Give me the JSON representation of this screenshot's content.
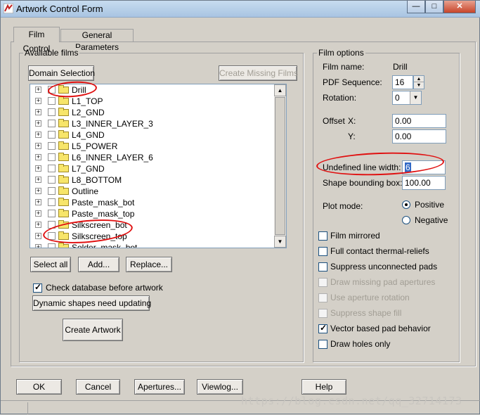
{
  "window": {
    "title": "Artwork Control Form"
  },
  "title_buttons": {
    "minimize": "—",
    "maximize": "□",
    "close": "✕"
  },
  "tabs": [
    {
      "label": "Film Control",
      "active": true
    },
    {
      "label": "General Parameters",
      "active": false
    }
  ],
  "available_films": {
    "group_label": "Available films",
    "domain_selection": "Domain Selection",
    "create_missing_films": "Create Missing Films",
    "films": [
      "Drill",
      "L1_TOP",
      "L2_GND",
      "L3_INNER_LAYER_3",
      "L4_GND",
      "L5_POWER",
      "L6_INNER_LAYER_6",
      "L7_GND",
      "L8_BOTTOM",
      "Outline",
      "Paste_mask_bot",
      "Paste_mask_top",
      "Silkscreen_bot",
      "Silkscreen_top",
      "Solder_mask_bot"
    ],
    "select_all": "Select all",
    "add": "Add...",
    "replace": "Replace...",
    "check_database": {
      "label": "Check database before artwork",
      "checked": true
    },
    "dynamic_shapes": "Dynamic shapes need updating",
    "create_artwork": "Create Artwork"
  },
  "film_options": {
    "group_label": "Film options",
    "film_name_label": "Film name:",
    "film_name_value": "Drill",
    "pdf_sequence_label": "PDF Sequence:",
    "pdf_sequence_value": "16",
    "rotation_label": "Rotation:",
    "rotation_value": "0",
    "offset_label": "Offset",
    "offset_x_label": "X:",
    "offset_x_value": "0.00",
    "offset_y_label": "Y:",
    "offset_y_value": "0.00",
    "undefined_line_width_label": "Undefined line width:",
    "undefined_line_width_value": "6",
    "shape_bounding_box_label": "Shape bounding box:",
    "shape_bounding_box_value": "100.00",
    "plot_mode_label": "Plot mode:",
    "plot_mode_positive": "Positive",
    "plot_mode_negative": "Negative",
    "plot_mode_selected": "Positive",
    "checkboxes": [
      {
        "label": "Film mirrored",
        "checked": false,
        "enabled": true
      },
      {
        "label": "Full contact thermal-reliefs",
        "checked": false,
        "enabled": true
      },
      {
        "label": "Suppress unconnected pads",
        "checked": false,
        "enabled": true
      },
      {
        "label": "Draw missing pad apertures",
        "checked": false,
        "enabled": false
      },
      {
        "label": "Use aperture rotation",
        "checked": false,
        "enabled": false
      },
      {
        "label": "Suppress shape fill",
        "checked": false,
        "enabled": false
      },
      {
        "label": "Vector based pad behavior",
        "checked": true,
        "enabled": true
      },
      {
        "label": "Draw holes only",
        "checked": false,
        "enabled": true
      }
    ]
  },
  "footer": {
    "ok": "OK",
    "cancel": "Cancel",
    "apertures": "Apertures...",
    "viewlog": "Viewlog...",
    "help": "Help"
  },
  "watermark": "https://blog.csdn.net/qq_32714173",
  "colors": {
    "annotation": "#e01010",
    "dialog_bg": "#d4d0c8"
  }
}
